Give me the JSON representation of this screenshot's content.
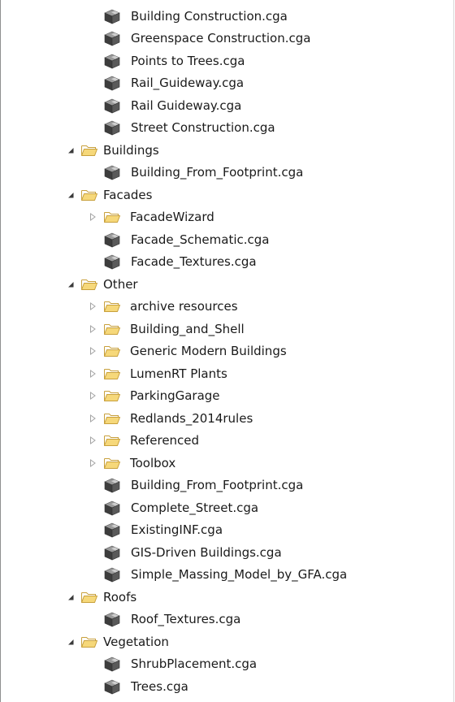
{
  "tree": {
    "rows": [
      {
        "label": "Building Construction.cga",
        "type": "file",
        "depth": 2
      },
      {
        "label": "Greenspace Construction.cga",
        "type": "file",
        "depth": 2
      },
      {
        "label": "Points to Trees.cga",
        "type": "file",
        "depth": 2
      },
      {
        "label": "Rail_Guideway.cga",
        "type": "file",
        "depth": 2
      },
      {
        "label": "Rail Guideway.cga",
        "type": "file",
        "depth": 2
      },
      {
        "label": "Street Construction.cga",
        "type": "file",
        "depth": 2
      },
      {
        "label": "Buildings",
        "type": "folder",
        "depth": 1,
        "expanded": true
      },
      {
        "label": "Building_From_Footprint.cga",
        "type": "file",
        "depth": 2
      },
      {
        "label": "Facades",
        "type": "folder",
        "depth": 1,
        "expanded": true
      },
      {
        "label": "FacadeWizard",
        "type": "folder",
        "depth": 2,
        "expanded": false
      },
      {
        "label": "Facade_Schematic.cga",
        "type": "file",
        "depth": 2
      },
      {
        "label": "Facade_Textures.cga",
        "type": "file",
        "depth": 2
      },
      {
        "label": "Other",
        "type": "folder",
        "depth": 1,
        "expanded": true
      },
      {
        "label": "archive resources",
        "type": "folder",
        "depth": 2,
        "expanded": false
      },
      {
        "label": "Building_and_Shell",
        "type": "folder",
        "depth": 2,
        "expanded": false
      },
      {
        "label": "Generic Modern Buildings",
        "type": "folder",
        "depth": 2,
        "expanded": false
      },
      {
        "label": "LumenRT Plants",
        "type": "folder",
        "depth": 2,
        "expanded": false
      },
      {
        "label": "ParkingGarage",
        "type": "folder",
        "depth": 2,
        "expanded": false
      },
      {
        "label": "Redlands_2014rules",
        "type": "folder",
        "depth": 2,
        "expanded": false
      },
      {
        "label": "Referenced",
        "type": "folder",
        "depth": 2,
        "expanded": false
      },
      {
        "label": "Toolbox",
        "type": "folder",
        "depth": 2,
        "expanded": false
      },
      {
        "label": "Building_From_Footprint.cga",
        "type": "file",
        "depth": 2
      },
      {
        "label": "Complete_Street.cga",
        "type": "file",
        "depth": 2
      },
      {
        "label": "ExistingINF.cga",
        "type": "file",
        "depth": 2
      },
      {
        "label": "GIS-Driven Buildings.cga",
        "type": "file",
        "depth": 2
      },
      {
        "label": "Simple_Massing_Model_by_GFA.cga",
        "type": "file",
        "depth": 2
      },
      {
        "label": "Roofs",
        "type": "folder",
        "depth": 1,
        "expanded": true
      },
      {
        "label": "Roof_Textures.cga",
        "type": "file",
        "depth": 2
      },
      {
        "label": "Vegetation",
        "type": "folder",
        "depth": 1,
        "expanded": true
      },
      {
        "label": "ShrubPlacement.cga",
        "type": "file",
        "depth": 2
      },
      {
        "label": "Trees.cga",
        "type": "file",
        "depth": 2
      }
    ]
  },
  "icons": {
    "file": "cga-rule-file-icon",
    "folder": "folder-open-icon",
    "expanded": "expanded-triangle-icon",
    "collapsed": "collapsed-triangle-icon"
  },
  "colors": {
    "folder_fill": "#f6d87a",
    "folder_stroke": "#c8a03c",
    "cube_dark": "#3d3d3d",
    "cube_light": "#9a9a9a",
    "triangle_expanded": "#3a3a3a",
    "triangle_collapsed": "#a3a3a3"
  }
}
